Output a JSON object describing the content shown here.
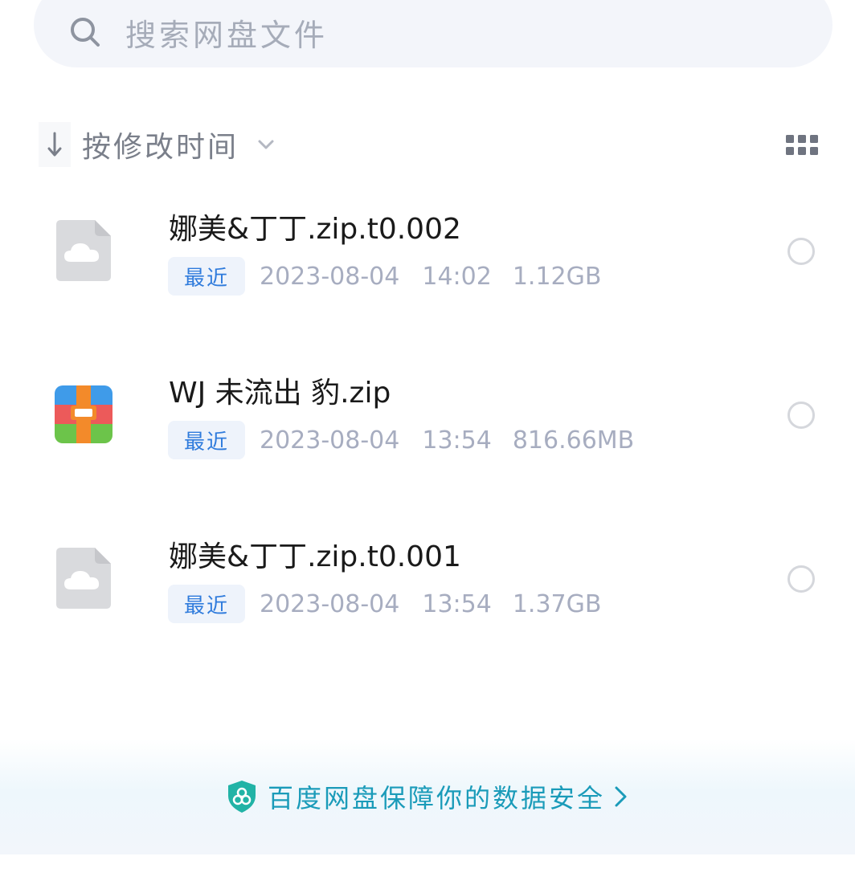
{
  "search": {
    "placeholder": "搜索网盘文件"
  },
  "sort": {
    "label": "按修改时间"
  },
  "files": [
    {
      "name": "娜美&丁丁.zip.t0.002",
      "badge": "最近",
      "date": "2023-08-04",
      "time": "14:02",
      "size": "1.12GB",
      "icon": "cloud-file-icon"
    },
    {
      "name": "WJ 未流出 豹.zip",
      "badge": "最近",
      "date": "2023-08-04",
      "time": "13:54",
      "size": "816.66MB",
      "icon": "zip-archive-icon"
    },
    {
      "name": "娜美&丁丁.zip.t0.001",
      "badge": "最近",
      "date": "2023-08-04",
      "time": "13:54",
      "size": "1.37GB",
      "icon": "cloud-file-icon"
    }
  ],
  "footer": {
    "security_text": "百度网盘保障你的数据安全"
  },
  "colors": {
    "accent": "#2f7bdc",
    "security": "#1a9bb9",
    "meta_text": "#a7adc0"
  }
}
